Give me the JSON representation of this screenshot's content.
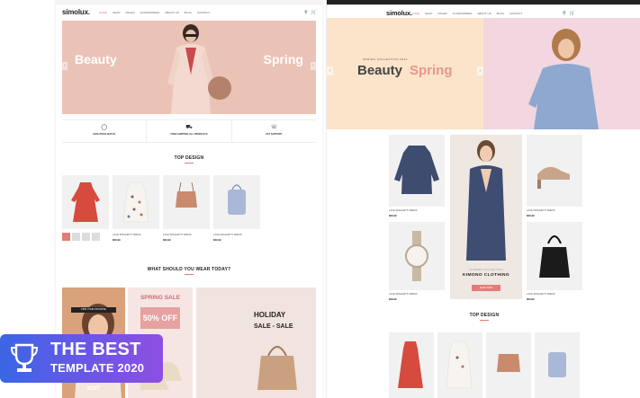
{
  "left_page": {
    "topbar_text": "",
    "logo": "simolux.",
    "menu": [
      "HOME",
      "SHOP",
      "PAGES",
      "ACCESSORIES",
      "ABOUT US",
      "BLOG",
      "CONTACT"
    ],
    "hero": {
      "title_left": "Beauty",
      "title_right": "Spring",
      "badge": ""
    },
    "features": [
      {
        "icon": "trophy-icon",
        "title": "100% PRICE MATCH",
        "sub": ""
      },
      {
        "icon": "truck-icon",
        "title": "FREE SHIPPING ALL PRODUCTS",
        "sub": ""
      },
      {
        "icon": "headset-icon",
        "title": "24/7 SUPPORT",
        "sub": ""
      }
    ],
    "section_top_design": "TOP DESIGN",
    "products": [
      {
        "label": "",
        "price": ""
      },
      {
        "label": "LACE SPAGHETTI DRESS",
        "price": "$29.99"
      },
      {
        "label": "LACE SPAGHETTI DRESS",
        "price": "$29.99"
      },
      {
        "label": "LACE SPAGHETTI DRESS",
        "price": "$29.99"
      }
    ],
    "section_wear": "WHAT SHOULD YOU WEAR TODAY?",
    "banners": {
      "b1_top": "FIND YOUR FAVORITE",
      "b1_bottom": "WHITE ON WHITE",
      "b1_bottom2": "EDIT",
      "b2_title": "SPRING SALE",
      "b2_big": "50% OFF",
      "b3_title": "HOLIDAY",
      "b3_sub": "SALE - SALE"
    }
  },
  "right_page": {
    "logo": "simolux.",
    "menu": [
      "HOME",
      "SHOP",
      "PAGES",
      "ACCESSORIES",
      "ABOUT US",
      "BLOG",
      "CONTACT"
    ],
    "hero": {
      "collection": "SPRING COLLECTION 2021",
      "title_a": "Beauty",
      "title_b": "Spring"
    },
    "products_left": [
      {
        "label": "LACE SPAGHETTI DRESS",
        "price": "$29.99"
      },
      {
        "label": "LACE SPAGHETTI DRESS",
        "price": "$29.99"
      }
    ],
    "products_right": [
      {
        "label": "LACE SPAGHETTI DRESS",
        "price": "$29.99"
      },
      {
        "label": "LACE SPAGHETTI DRESS",
        "price": "$29.99"
      }
    ],
    "kimono": {
      "kicker": "SUMMER COLLECTION",
      "title": "KIMONO CLOTHING",
      "button": "SHOP NOW"
    },
    "section_top_design": "TOP DESIGN"
  },
  "award": {
    "line1": "THE BEST",
    "line2": "TEMPLATE 2020",
    "accent_start": "#3a66e6",
    "accent_end": "#8e4fe2"
  }
}
